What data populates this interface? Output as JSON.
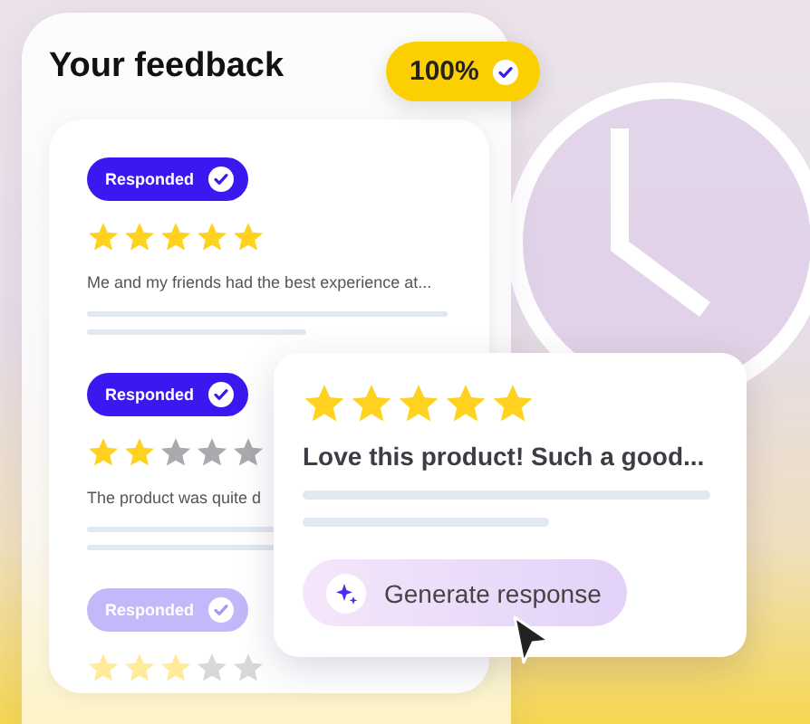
{
  "title": "Your feedback",
  "completion_badge": {
    "label": "100%"
  },
  "reviews": [
    {
      "status": "Responded",
      "stars": 5,
      "text": "Me and my friends had the best experience at...",
      "faded": false
    },
    {
      "status": "Responded",
      "stars": 2,
      "text": "The product was quite d",
      "faded": false
    },
    {
      "status": "Responded",
      "stars": 3,
      "faded": true
    }
  ],
  "popup": {
    "stars": 5,
    "text": "Love this product! Such a good...",
    "button": "Generate response"
  }
}
